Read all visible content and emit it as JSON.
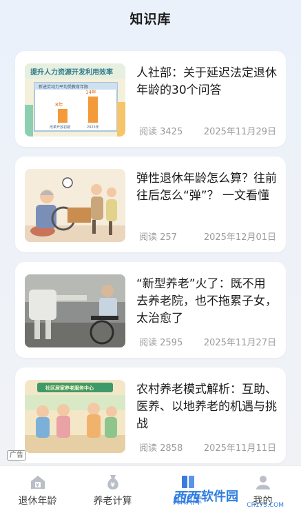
{
  "header": {
    "title": "知识库"
  },
  "articles": [
    {
      "title": "人社部：关于延迟法定退休年龄的30个问答",
      "reads": "阅读 3425",
      "date": "2025年11月29日",
      "thumb_banner": "提升人力资源开发利用效率",
      "thumb_sub": "新进劳动力平均受教育年限",
      "thumb_v1": "8年",
      "thumb_v2": "14年",
      "thumb_y1": "改革开放初期",
      "thumb_y2": "2023年"
    },
    {
      "title": "弹性退休年龄怎么算？往前往后怎么“弹”？ 一文看懂",
      "reads": "阅读 257",
      "date": "2025年12月01日"
    },
    {
      "title": "“新型养老”火了：既不用去养老院，也不拖累子女，太治愈了",
      "reads": "阅读 2595",
      "date": "2025年11月27日"
    },
    {
      "title": "农村养老模式解析：互助、医养、以地养老的机遇与挑战",
      "reads": "阅读 2858",
      "date": "2025年11月11日",
      "thumb_banner": "社区居家养老服务中心"
    }
  ],
  "ad_label": "广告",
  "tabs": [
    {
      "label": "退休年龄",
      "icon": "house-icon",
      "active": false
    },
    {
      "label": "养老计算",
      "icon": "money-bag-icon",
      "active": false
    },
    {
      "label": "知识库",
      "icon": "book-icon",
      "active": true
    },
    {
      "label": "我的",
      "icon": "user-icon",
      "active": false
    }
  ],
  "watermark": {
    "logo": "西西",
    "text": "软件园",
    "sub": "CR173.COM"
  },
  "colors": {
    "accent": "#3a7be0",
    "card_bg": "#ffffff",
    "meta_text": "#9a9a9a"
  }
}
